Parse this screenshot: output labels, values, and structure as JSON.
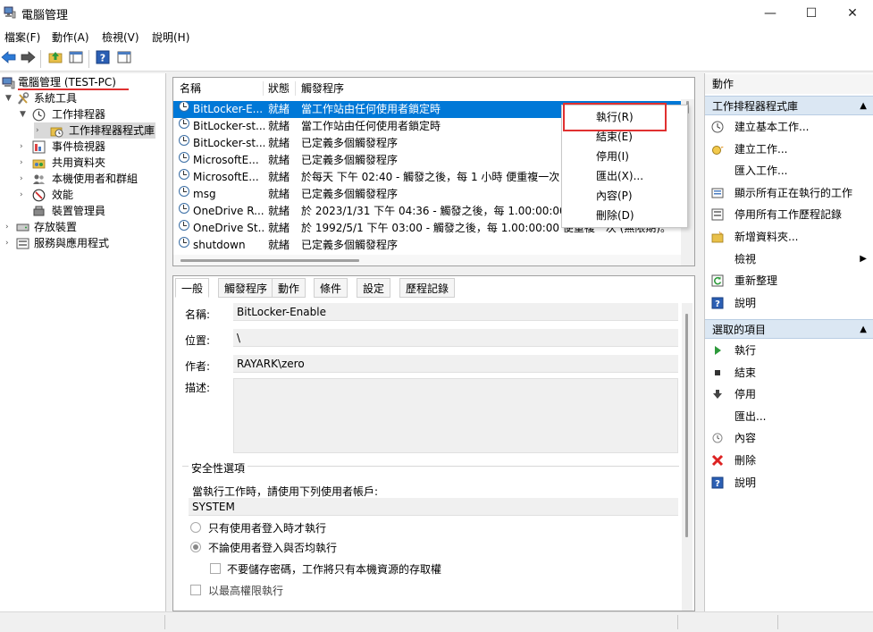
{
  "window": {
    "title": "電腦管理",
    "minimize_glyph": "—",
    "maximize_glyph": "☐",
    "close_glyph": "✕"
  },
  "menu": [
    "檔案(F)",
    "動作(A)",
    "檢視(V)",
    "說明(H)"
  ],
  "toolbar": {
    "icons": [
      "back-arrow-icon",
      "forward-arrow-icon",
      "up-folder-icon",
      "show-hide-console-tree-icon",
      "help-icon",
      "show-hide-action-pane-icon"
    ]
  },
  "tree": {
    "root": "電腦管理 (TEST-PC)",
    "system_tools": "系統工具",
    "task_scheduler": "工作排程器",
    "task_scheduler_library": "工作排程器程式庫",
    "event_viewer": "事件檢視器",
    "shared_folders": "共用資料夾",
    "local_users_groups": "本機使用者和群組",
    "performance": "效能",
    "device_manager": "裝置管理員",
    "storage": "存放裝置",
    "services_apps": "服務與應用程式"
  },
  "task_list": {
    "columns": [
      "名稱",
      "狀態",
      "觸發程序"
    ],
    "rows": [
      {
        "name": "BitLocker-E...",
        "status": "就緒",
        "trigger": "當工作站由任何使用者鎖定時"
      },
      {
        "name": "BitLocker-st...",
        "status": "就緒",
        "trigger": "當工作站由任何使用者鎖定時"
      },
      {
        "name": "BitLocker-st...",
        "status": "就緒",
        "trigger": "已定義多個觸發程序"
      },
      {
        "name": "MicrosoftE...",
        "status": "就緒",
        "trigger": "已定義多個觸發程序"
      },
      {
        "name": "MicrosoftE...",
        "status": "就緒",
        "trigger": "於每天 下午 02:40 - 觸發之後，每 1 小時 便重複一次 (持"
      },
      {
        "name": "msg",
        "status": "就緒",
        "trigger": "已定義多個觸發程序"
      },
      {
        "name": "OneDrive R...",
        "status": "就緒",
        "trigger": "於 2023/1/31 下午 04:36 - 觸發之後，每 1.00:00:00 便"
      },
      {
        "name": "OneDrive St...",
        "status": "就緒",
        "trigger": "於 1992/5/1 下午 03:00 - 觸發之後，每 1.00:00:00 便重複一次 (無限期)。"
      },
      {
        "name": "shutdown",
        "status": "就緒",
        "trigger": "已定義多個觸發程序"
      }
    ],
    "selected_index": 0
  },
  "context_menu": [
    "執行(R)",
    "結束(E)",
    "停用(I)",
    "匯出(X)...",
    "內容(P)",
    "刪除(D)"
  ],
  "detail": {
    "tabs": [
      "一般",
      "觸發程序",
      "動作",
      "條件",
      "設定",
      "歷程記錄"
    ],
    "active_tab": 0,
    "name_label": "名稱:",
    "name_value": "BitLocker-Enable",
    "location_label": "位置:",
    "location_value": "\\",
    "author_label": "作者:",
    "author_value": "RAYARK\\zero",
    "description_label": "描述:",
    "description_value": "",
    "security_group": "安全性選項",
    "run_as_text": "當執行工作時，請使用下列使用者帳戶:",
    "run_as_user": "SYSTEM",
    "option_logged_on": "只有使用者登入時才執行",
    "option_whether_logged_on": "不論使用者登入與否均執行",
    "option_no_password": "不要儲存密碼，工作將只有本機資源的存取權",
    "option_highest_privileges": "以最高權限執行"
  },
  "actions": {
    "header": "動作",
    "library_group": "工作排程器程式庫",
    "library_items": [
      {
        "label": "建立基本工作...",
        "icon": "create-basic-task-icon"
      },
      {
        "label": "建立工作...",
        "icon": "create-task-icon"
      },
      {
        "label": "匯入工作...",
        "icon": ""
      },
      {
        "label": "顯示所有正在執行的工作",
        "icon": "running-tasks-icon"
      },
      {
        "label": "停用所有工作歷程記錄",
        "icon": "history-icon"
      },
      {
        "label": "新增資料夾...",
        "icon": "new-folder-icon"
      },
      {
        "label": "檢視",
        "icon": ""
      },
      {
        "label": "重新整理",
        "icon": "refresh-icon"
      },
      {
        "label": "說明",
        "icon": "help-icon"
      }
    ],
    "selected_group": "選取的項目",
    "selected_items": [
      {
        "label": "執行",
        "icon": "run-icon"
      },
      {
        "label": "結束",
        "icon": "end-icon"
      },
      {
        "label": "停用",
        "icon": "disable-icon"
      },
      {
        "label": "匯出...",
        "icon": ""
      },
      {
        "label": "內容",
        "icon": "properties-icon"
      },
      {
        "label": "刪除",
        "icon": "delete-icon"
      },
      {
        "label": "說明",
        "icon": "help-icon"
      }
    ]
  },
  "colors": {
    "selection": "#0078d7",
    "highlight_box": "#e03030",
    "root_underline": "#e03030",
    "group_header": "#dbe7f3"
  }
}
